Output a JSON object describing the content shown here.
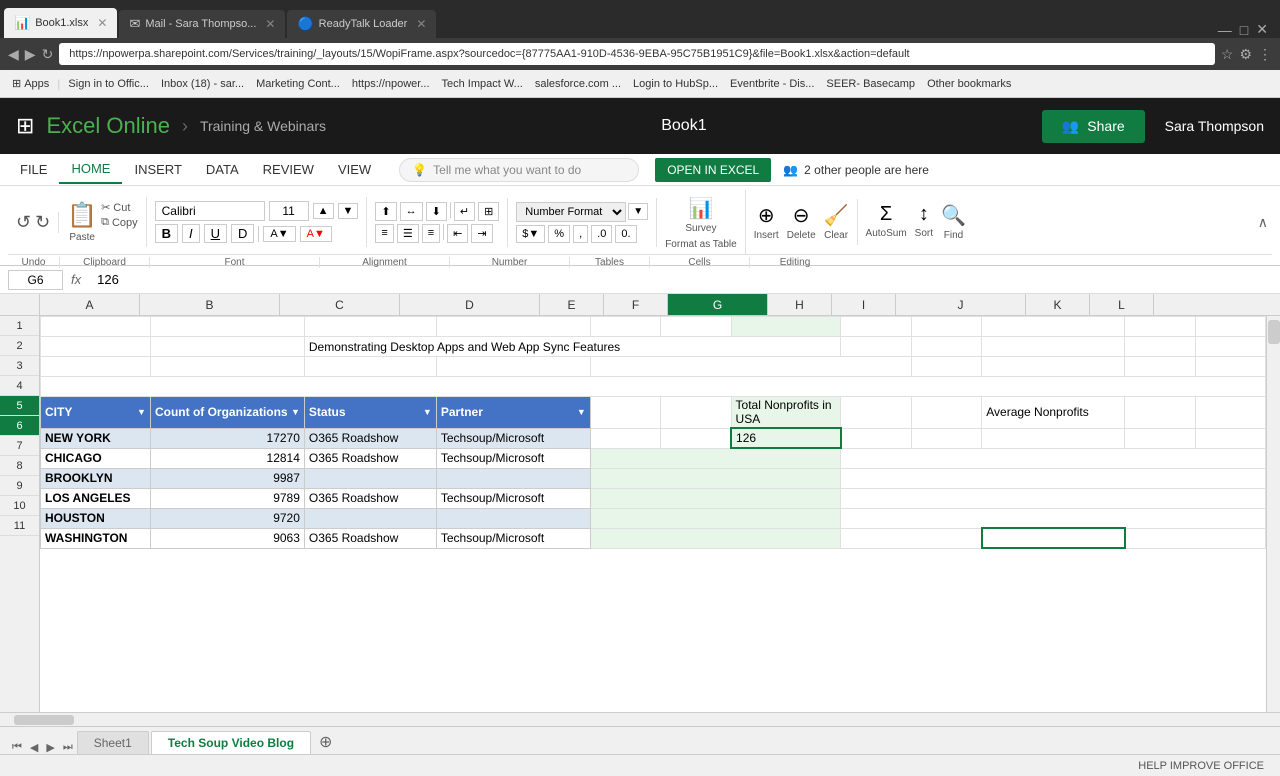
{
  "browser": {
    "tabs": [
      {
        "label": "Book1.xlsx",
        "icon": "📊",
        "active": true
      },
      {
        "label": "Mail - Sara Thompso...",
        "icon": "✉",
        "active": false
      },
      {
        "label": "ReadyTalk Loader",
        "icon": "🔵",
        "active": false
      }
    ],
    "address": "https://npowerpa.sharepoint.com/Services/training/_layouts/15/WopiFrame.aspx?sourcedoc={87775AA1-910D-4536-9EBA-95C75B1951C9}&file=Book1.xlsx&action=default",
    "bookmarks": [
      {
        "label": "Apps"
      },
      {
        "label": "Sign in to Offic..."
      },
      {
        "label": "Inbox (18) - sar..."
      },
      {
        "label": "Marketing Cont..."
      },
      {
        "label": "https://npower..."
      },
      {
        "label": "Tech Impact W..."
      },
      {
        "label": "salesforce.com ..."
      },
      {
        "label": "Login to HubSp..."
      },
      {
        "label": "Eventbrite - Dis..."
      },
      {
        "label": "SEER- Basecamp"
      },
      {
        "label": "Other bookmarks"
      }
    ]
  },
  "excel": {
    "app_title": "Excel Online",
    "breadcrumb": "Training & Webinars",
    "filename": "Book1",
    "share_label": "Share",
    "user_name": "Sara Thompson",
    "collab_text": "2 other people are here"
  },
  "ribbon": {
    "menu_items": [
      {
        "label": "FILE",
        "active": false
      },
      {
        "label": "HOME",
        "active": true
      },
      {
        "label": "INSERT",
        "active": false
      },
      {
        "label": "DATA",
        "active": false
      },
      {
        "label": "REVIEW",
        "active": false
      },
      {
        "label": "VIEW",
        "active": false
      }
    ],
    "tell_me_placeholder": "Tell me what you want to do",
    "open_excel_label": "OPEN IN EXCEL",
    "undo_label": "Undo",
    "redo_label": "Redo",
    "paste_label": "Paste",
    "cut_label": "Cut",
    "copy_label": "Copy",
    "font_name": "Calibri",
    "font_size": "11",
    "bold_label": "B",
    "italic_label": "I",
    "underline_label": "U",
    "strikethrough_label": "D",
    "number_format": "Number Format",
    "autosum_label": "AutoSum",
    "sort_label": "Sort",
    "find_label": "Find",
    "survey_label": "Survey",
    "format_as_table_label": "Format as Table",
    "insert_label": "Insert",
    "delete_label": "Delete",
    "clear_label": "Clear",
    "sections": [
      "Undo",
      "Clipboard",
      "Font",
      "Alignment",
      "Number",
      "Tables",
      "Cells",
      "Editing"
    ]
  },
  "formula_bar": {
    "cell_ref": "G6",
    "formula": "126"
  },
  "columns": {
    "headers": [
      "A",
      "B",
      "C",
      "D",
      "E",
      "F",
      "G",
      "H",
      "I",
      "J",
      "K",
      "L"
    ],
    "widths": [
      100,
      140,
      120,
      140,
      64,
      64,
      100,
      64,
      64,
      130,
      64,
      64
    ],
    "selected": "G"
  },
  "rows": {
    "count": 11,
    "headers": [
      "1",
      "2",
      "3",
      "4",
      "5",
      "6",
      "7",
      "8",
      "9",
      "10",
      "11"
    ]
  },
  "cells": {
    "title_row": {
      "col": "C",
      "row": 2,
      "value": "Demonstrating Desktop Apps and Web App Sync Features"
    },
    "table_headers": {
      "city": "CITY",
      "count": "Count of Organizations",
      "status": "Status",
      "partner": "Partner",
      "total_nonprofits": "Total Nonprofits in USA",
      "average_nonprofits": "Average Nonprofits"
    },
    "data_rows": [
      {
        "city": "NEW YORK",
        "count": "17270",
        "status": "O365 Roadshow",
        "partner": "Techsoup/Microsoft"
      },
      {
        "city": "CHICAGO",
        "count": "12814",
        "status": "O365 Roadshow",
        "partner": "Techsoup/Microsoft"
      },
      {
        "city": "BROOKLYN",
        "count": "9987",
        "status": "",
        "partner": ""
      },
      {
        "city": "LOS ANGELES",
        "count": "9789",
        "status": "O365 Roadshow",
        "partner": "Techsoup/Microsoft"
      },
      {
        "city": "HOUSTON",
        "count": "9720",
        "status": "",
        "partner": ""
      },
      {
        "city": "WASHINGTON",
        "count": "9063",
        "status": "O365 Roadshow",
        "partner": "Techsoup/Microsoft"
      }
    ],
    "active_cell_value": "126"
  },
  "sheet_tabs": [
    {
      "label": "Sheet1",
      "active": false
    },
    {
      "label": "Tech Soup Video Blog",
      "active": true
    }
  ],
  "status": {
    "help_text": "HELP IMPROVE OFFICE"
  }
}
